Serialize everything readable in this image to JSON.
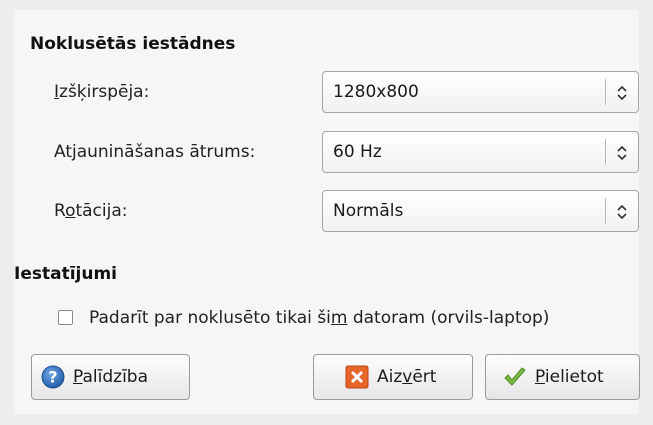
{
  "default_settings": {
    "title": "Noklusētās iestādnes",
    "resolution": {
      "label_before": "",
      "label_ul": "I",
      "label_after": "zšķirspēja:",
      "value": "1280x800"
    },
    "refresh": {
      "label": "Atjaunināšanas ātrums:",
      "value": "60 Hz"
    },
    "rotation": {
      "label_before": "R",
      "label_ul": "o",
      "label_after": "tācija:",
      "value": "Normāls"
    }
  },
  "settings": {
    "title": "Iestatījumi",
    "checkbox": {
      "checked": false,
      "label_before": "Padarīt par noklusēto tikai ši",
      "label_ul": "m",
      "label_after": " datoram (orvils-laptop)"
    }
  },
  "buttons": {
    "help": {
      "before": "",
      "ul": "P",
      "after": "alīdzība",
      "icon": "help-icon",
      "color": "#2f6db5"
    },
    "close": {
      "before": "Aiz",
      "ul": "v",
      "after": "ērt",
      "icon": "close-icon",
      "color": "#e8652a"
    },
    "apply": {
      "before": "",
      "ul": "P",
      "after": "ielietot",
      "icon": "checkmark-icon",
      "color": "#6aaa3a"
    }
  }
}
